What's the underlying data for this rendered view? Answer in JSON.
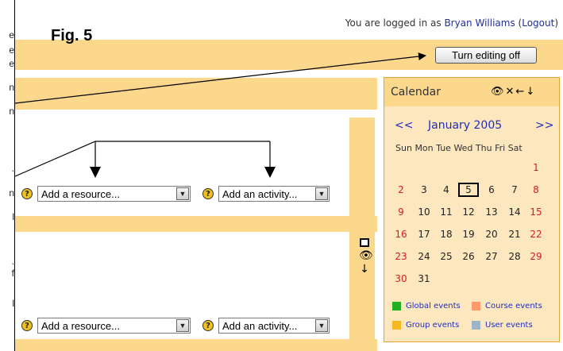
{
  "left_fragments": [
    "e",
    "e",
    "e",
    "n",
    "n",
    ".",
    "n",
    "l",
    ".",
    "f",
    "l"
  ],
  "header": {
    "logged_in_text": "You are logged in as",
    "user_name": "Bryan Williams",
    "logout_label": "Logout",
    "figure_label": "Fig. 5",
    "edit_button_label": "Turn editing off"
  },
  "sections": [
    {
      "resource_placeholder": "Add a resource...",
      "activity_placeholder": "Add an activity..."
    },
    {
      "resource_placeholder": "Add a resource...",
      "activity_placeholder": "Add an activity..."
    }
  ],
  "section_icons": [
    "box-icon",
    "eye-icon",
    "arrow-down-icon"
  ],
  "calendar": {
    "title": "Calendar",
    "header_icons": [
      "eye-icon",
      "close-icon",
      "arrow-left-icon",
      "arrow-down-icon"
    ],
    "prev_label": "<<",
    "next_label": ">>",
    "month_label": "January 2005",
    "weekdays": [
      "Sun",
      "Mon",
      "Tue",
      "Wed",
      "Thu",
      "Fri",
      "Sat"
    ],
    "weeks": [
      [
        "",
        "",
        "",
        "",
        "",
        "",
        "1"
      ],
      [
        "2",
        "3",
        "4",
        "5",
        "6",
        "7",
        "8"
      ],
      [
        "9",
        "10",
        "11",
        "12",
        "13",
        "14",
        "15"
      ],
      [
        "16",
        "17",
        "18",
        "19",
        "20",
        "21",
        "22"
      ],
      [
        "23",
        "24",
        "25",
        "26",
        "27",
        "28",
        "29"
      ],
      [
        "30",
        "31",
        "",
        "",
        "",
        "",
        ""
      ]
    ],
    "today": "5",
    "legend": [
      {
        "label": "Global events",
        "color": "#22b022"
      },
      {
        "label": "Course events",
        "color": "#ff9a6a"
      },
      {
        "label": "Group events",
        "color": "#f5b820"
      },
      {
        "label": "User events",
        "color": "#9fb4c8"
      }
    ]
  },
  "colors": {
    "band": "#fbd88c",
    "calendar_bg": "#fce7bf",
    "link": "#1f2fbf",
    "weekend": "#d02020"
  }
}
